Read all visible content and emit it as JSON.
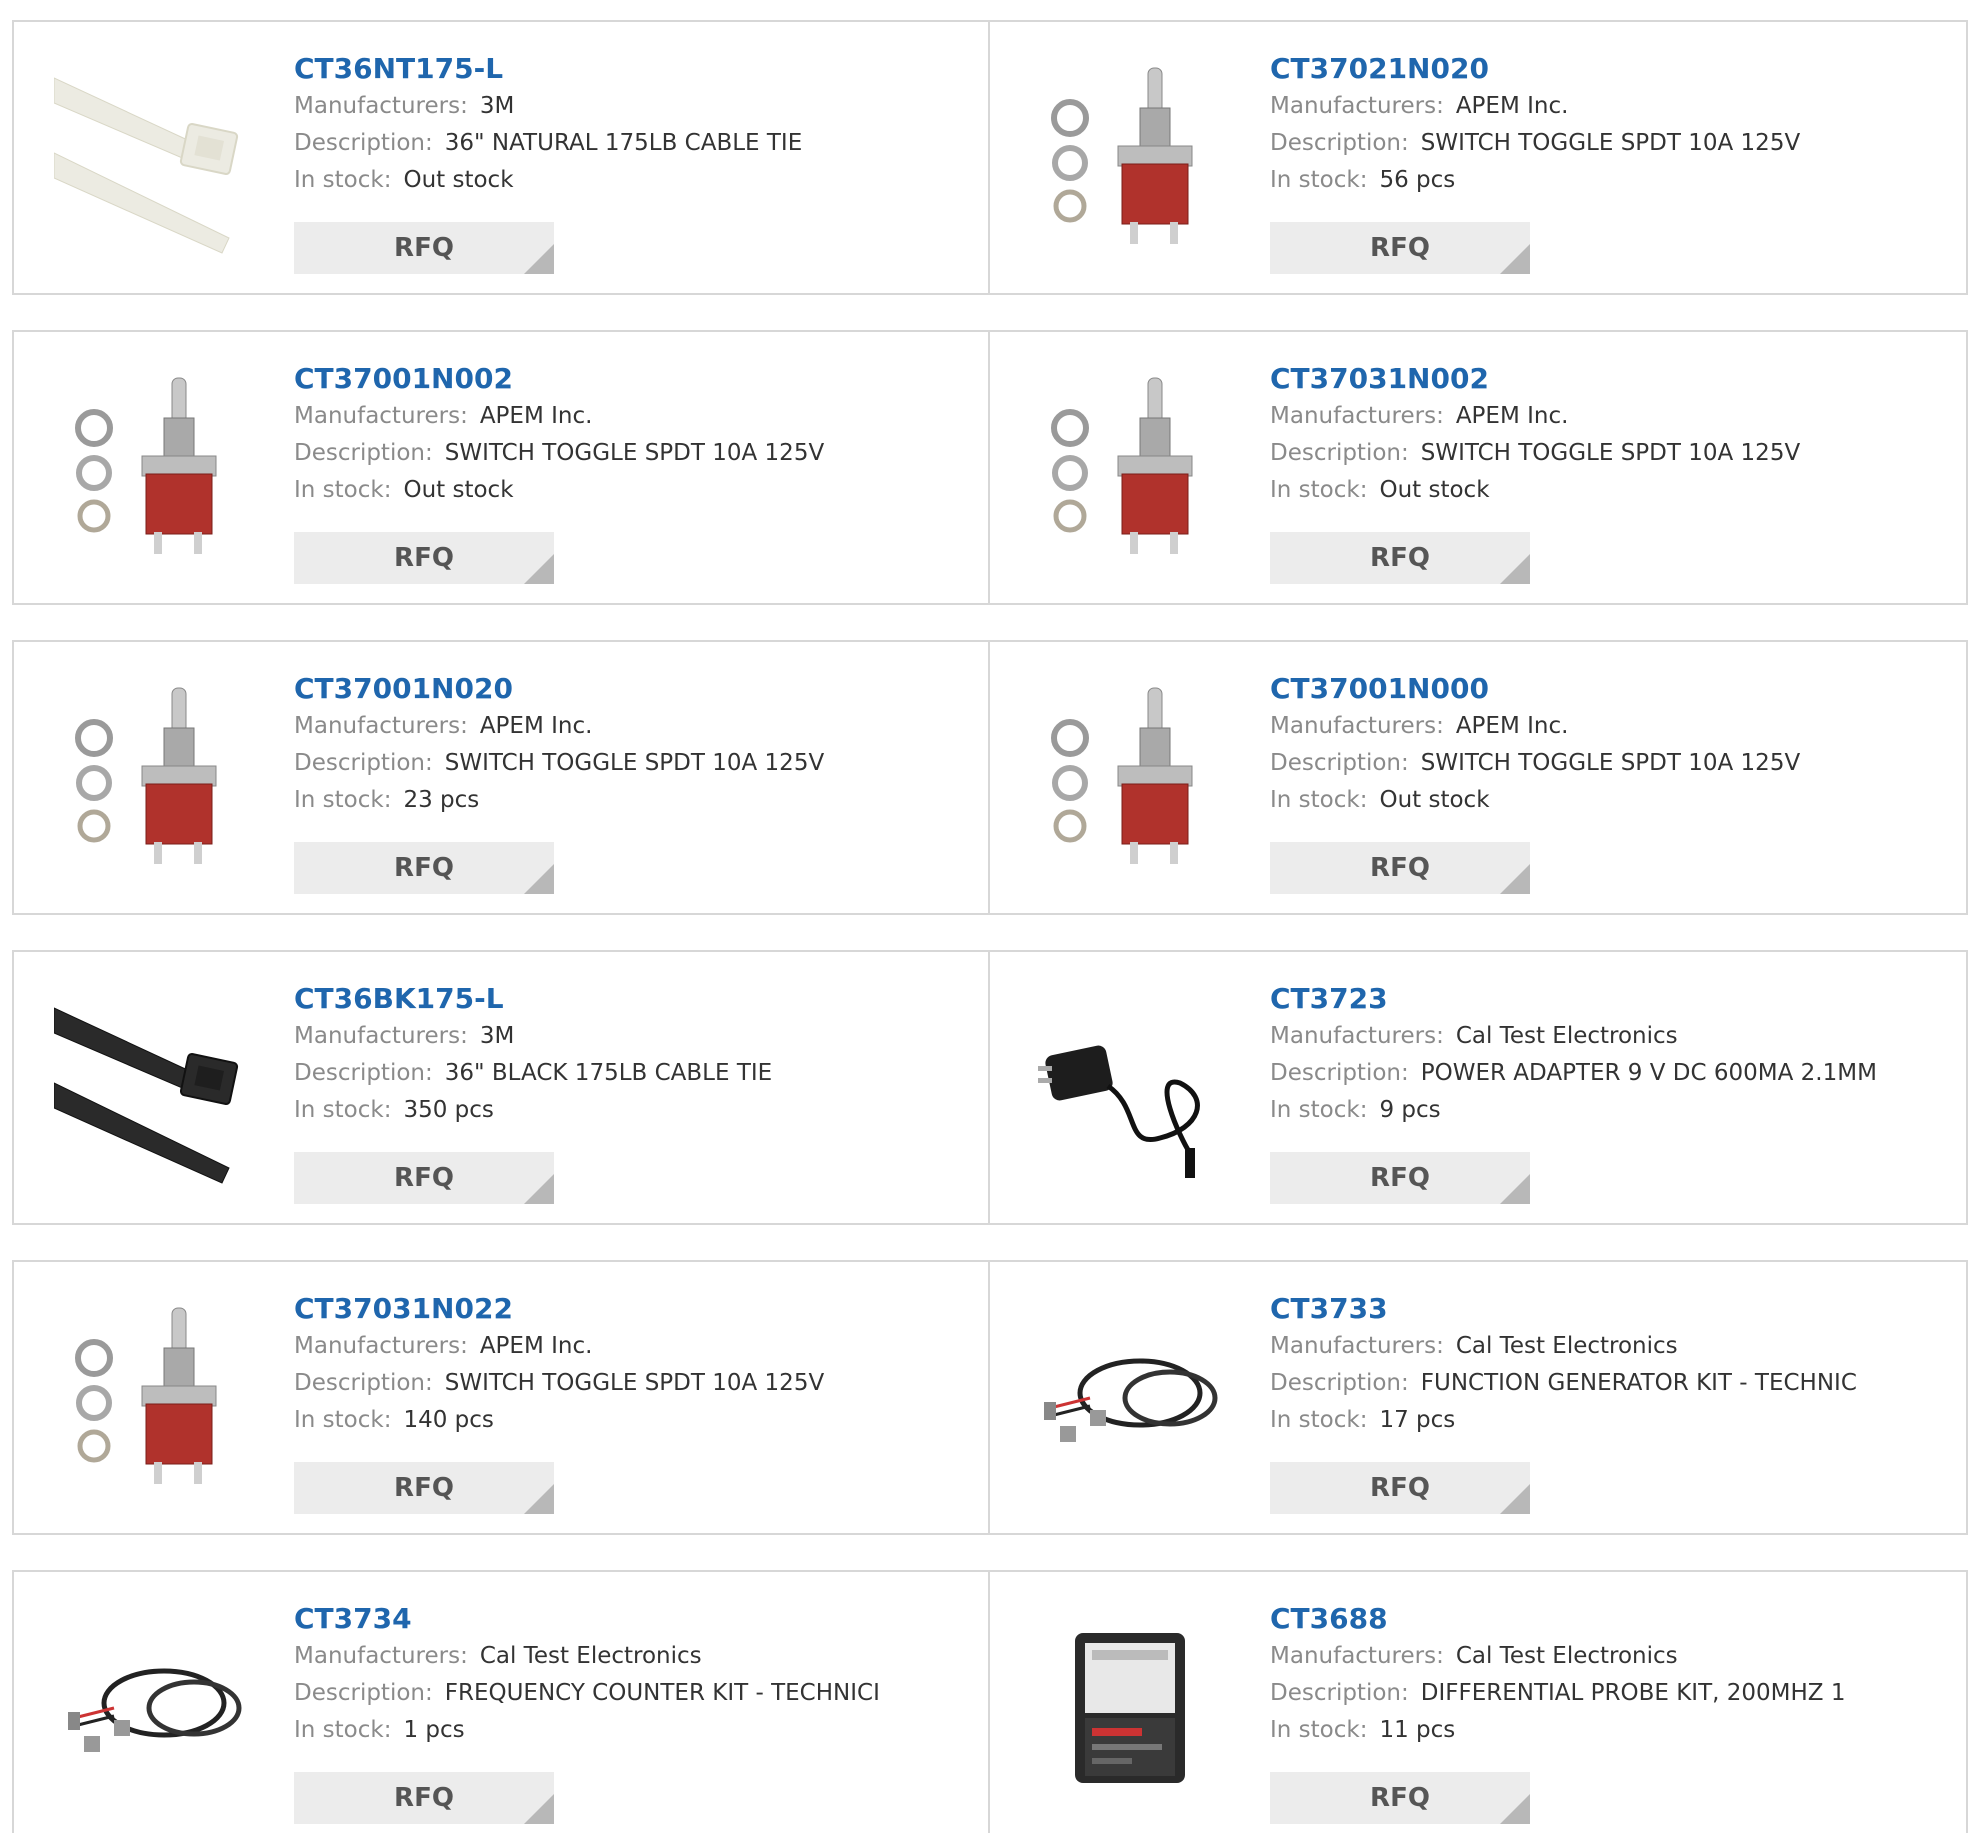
{
  "labels": {
    "manufacturers": "Manufacturers:",
    "description": "Description:",
    "in_stock": "In stock:",
    "rfq": "RFQ"
  },
  "products": [
    {
      "part": "CT36NT175-L",
      "manufacturer": "3M",
      "description": "36\" NATURAL 175LB CABLE TIE",
      "stock": "Out stock",
      "image": "cable-tie-natural-image"
    },
    {
      "part": "CT37021N020",
      "manufacturer": "APEM Inc.",
      "description": "SWITCH TOGGLE SPDT 10A 125V",
      "stock": "56 pcs",
      "image": "toggle-switch-image"
    },
    {
      "part": "CT37001N002",
      "manufacturer": "APEM Inc.",
      "description": "SWITCH TOGGLE SPDT 10A 125V",
      "stock": "Out stock",
      "image": "toggle-switch-image"
    },
    {
      "part": "CT37031N002",
      "manufacturer": "APEM Inc.",
      "description": "SWITCH TOGGLE SPDT 10A 125V",
      "stock": "Out stock",
      "image": "toggle-switch-image"
    },
    {
      "part": "CT37001N020",
      "manufacturer": "APEM Inc.",
      "description": "SWITCH TOGGLE SPDT 10A 125V",
      "stock": "23 pcs",
      "image": "toggle-switch-image"
    },
    {
      "part": "CT37001N000",
      "manufacturer": "APEM Inc.",
      "description": "SWITCH TOGGLE SPDT 10A 125V",
      "stock": "Out stock",
      "image": "toggle-switch-image"
    },
    {
      "part": "CT36BK175-L",
      "manufacturer": "3M",
      "description": "36\" BLACK 175LB CABLE TIE",
      "stock": "350 pcs",
      "image": "cable-tie-black-image"
    },
    {
      "part": "CT3723",
      "manufacturer": "Cal Test Electronics",
      "description": "POWER ADAPTER 9 V DC 600MA 2.1MM",
      "stock": "9 pcs",
      "image": "power-adapter-image"
    },
    {
      "part": "CT37031N022",
      "manufacturer": "APEM Inc.",
      "description": "SWITCH TOGGLE SPDT 10A 125V",
      "stock": "140 pcs",
      "image": "toggle-switch-image"
    },
    {
      "part": "CT3733",
      "manufacturer": "Cal Test Electronics",
      "description": "FUNCTION GENERATOR KIT - TECHNIC",
      "stock": "17 pcs",
      "image": "cable-kit-image"
    },
    {
      "part": "CT3734",
      "manufacturer": "Cal Test Electronics",
      "description": "FREQUENCY COUNTER KIT - TECHNICI",
      "stock": "1 pcs",
      "image": "cable-kit-image"
    },
    {
      "part": "CT3688",
      "manufacturer": "Cal Test Electronics",
      "description": "DIFFERENTIAL PROBE KIT, 200MHZ 1",
      "stock": "11 pcs",
      "image": "probe-kit-case-image"
    }
  ],
  "colors": {
    "part_link": "#1f66ad",
    "label": "#8a8a8a",
    "value": "#333333",
    "border": "#d7d7d7",
    "button_bg": "#ececec"
  }
}
